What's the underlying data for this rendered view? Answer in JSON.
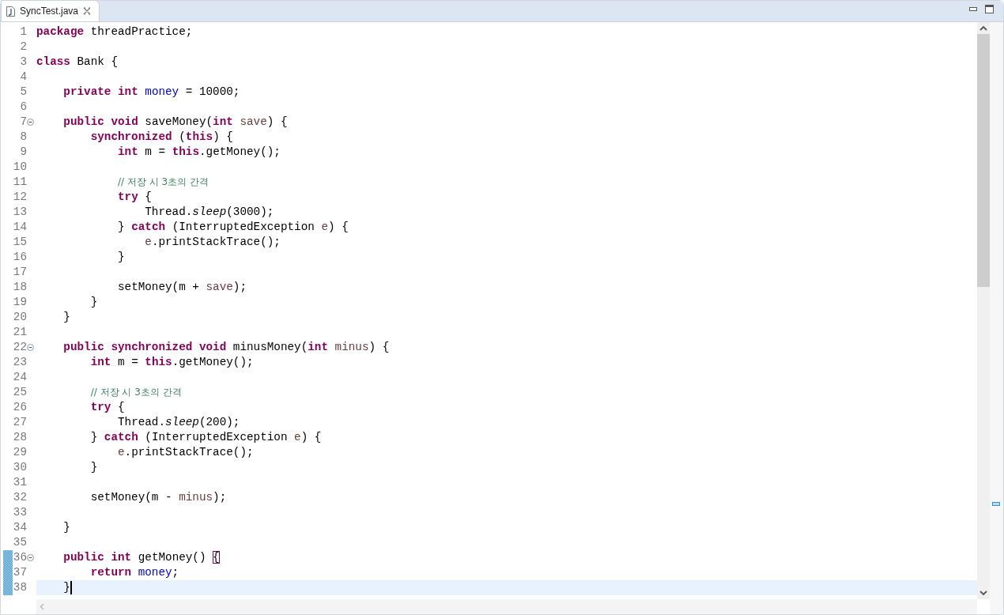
{
  "tab": {
    "title": "SyncTest.java",
    "selected": true
  },
  "lines": [
    {
      "number": "1",
      "tokens": [
        {
          "kind": "keyword",
          "text": "package"
        },
        {
          "kind": "plain",
          "text": " threadPractice;"
        }
      ]
    },
    {
      "number": "2"
    },
    {
      "number": "3",
      "tokens": [
        {
          "kind": "keyword",
          "text": "class"
        },
        {
          "kind": "plain",
          "text": " Bank {"
        }
      ]
    },
    {
      "number": "4"
    },
    {
      "number": "5",
      "tokens": [
        {
          "kind": "keyword",
          "text": "    private "
        },
        {
          "kind": "keyword",
          "text": "int "
        },
        {
          "kind": "field",
          "text": "money"
        },
        {
          "kind": "plain",
          "text": " = 10000;"
        }
      ]
    },
    {
      "number": "6"
    },
    {
      "number": "7",
      "foldable": true,
      "tokens": [
        {
          "kind": "keyword",
          "text": "    public "
        },
        {
          "kind": "keyword",
          "text": "void"
        },
        {
          "kind": "plain",
          "text": " saveMoney("
        },
        {
          "kind": "keyword",
          "text": "int "
        },
        {
          "kind": "param",
          "text": "save"
        },
        {
          "kind": "plain",
          "text": ") {"
        }
      ]
    },
    {
      "number": "8",
      "tokens": [
        {
          "kind": "keyword",
          "text": "        synchronized"
        },
        {
          "kind": "plain",
          "text": " ("
        },
        {
          "kind": "keyword",
          "text": "this"
        },
        {
          "kind": "plain",
          "text": ") {"
        }
      ]
    },
    {
      "number": "9",
      "tokens": [
        {
          "kind": "keyword",
          "text": "            int"
        },
        {
          "kind": "plain",
          "text": " m = "
        },
        {
          "kind": "keyword",
          "text": "this"
        },
        {
          "kind": "plain",
          "text": ".getMoney();"
        }
      ]
    },
    {
      "number": "10"
    },
    {
      "number": "11",
      "tokens": [
        {
          "kind": "comment",
          "text": "            // 저장 시 3초의 간격"
        }
      ]
    },
    {
      "number": "12",
      "tokens": [
        {
          "kind": "keyword",
          "text": "            try"
        },
        {
          "kind": "plain",
          "text": " {"
        }
      ]
    },
    {
      "number": "13",
      "tokens": [
        {
          "kind": "plain",
          "text": "                Thread."
        },
        {
          "kind": "static",
          "text": "sleep"
        },
        {
          "kind": "plain",
          "text": "(3000);"
        }
      ]
    },
    {
      "number": "14",
      "tokens": [
        {
          "kind": "plain",
          "text": "            } "
        },
        {
          "kind": "keyword",
          "text": "catch"
        },
        {
          "kind": "plain",
          "text": " (InterruptedException "
        },
        {
          "kind": "param",
          "text": "e"
        },
        {
          "kind": "plain",
          "text": ") {"
        }
      ]
    },
    {
      "number": "15",
      "tokens": [
        {
          "kind": "param",
          "text": "                e"
        },
        {
          "kind": "plain",
          "text": ".printStackTrace();"
        }
      ]
    },
    {
      "number": "16",
      "tokens": [
        {
          "kind": "plain",
          "text": "            }"
        }
      ]
    },
    {
      "number": "17"
    },
    {
      "number": "18",
      "tokens": [
        {
          "kind": "plain",
          "text": "            setMoney(m + "
        },
        {
          "kind": "param",
          "text": "save"
        },
        {
          "kind": "plain",
          "text": ");"
        }
      ]
    },
    {
      "number": "19",
      "tokens": [
        {
          "kind": "plain",
          "text": "        }"
        }
      ]
    },
    {
      "number": "20",
      "tokens": [
        {
          "kind": "plain",
          "text": "    }"
        }
      ]
    },
    {
      "number": "21"
    },
    {
      "number": "22",
      "foldable": true,
      "tokens": [
        {
          "kind": "keyword",
          "text": "    public "
        },
        {
          "kind": "keyword",
          "text": "synchronized "
        },
        {
          "kind": "keyword",
          "text": "void"
        },
        {
          "kind": "plain",
          "text": " minusMoney("
        },
        {
          "kind": "keyword",
          "text": "int "
        },
        {
          "kind": "param",
          "text": "minus"
        },
        {
          "kind": "plain",
          "text": ") {"
        }
      ]
    },
    {
      "number": "23",
      "tokens": [
        {
          "kind": "keyword",
          "text": "        int"
        },
        {
          "kind": "plain",
          "text": " m = "
        },
        {
          "kind": "keyword",
          "text": "this"
        },
        {
          "kind": "plain",
          "text": ".getMoney();"
        }
      ]
    },
    {
      "number": "24"
    },
    {
      "number": "25",
      "tokens": [
        {
          "kind": "comment",
          "text": "        // 저장 시 3초의 간격"
        }
      ]
    },
    {
      "number": "26",
      "tokens": [
        {
          "kind": "keyword",
          "text": "        try"
        },
        {
          "kind": "plain",
          "text": " {"
        }
      ]
    },
    {
      "number": "27",
      "tokens": [
        {
          "kind": "plain",
          "text": "            Thread."
        },
        {
          "kind": "static",
          "text": "sleep"
        },
        {
          "kind": "plain",
          "text": "(200);"
        }
      ]
    },
    {
      "number": "28",
      "tokens": [
        {
          "kind": "plain",
          "text": "        } "
        },
        {
          "kind": "keyword",
          "text": "catch"
        },
        {
          "kind": "plain",
          "text": " (InterruptedException "
        },
        {
          "kind": "param",
          "text": "e"
        },
        {
          "kind": "plain",
          "text": ") {"
        }
      ]
    },
    {
      "number": "29",
      "tokens": [
        {
          "kind": "param",
          "text": "            e"
        },
        {
          "kind": "plain",
          "text": ".printStackTrace();"
        }
      ]
    },
    {
      "number": "30",
      "tokens": [
        {
          "kind": "plain",
          "text": "        }"
        }
      ]
    },
    {
      "number": "31"
    },
    {
      "number": "32",
      "tokens": [
        {
          "kind": "plain",
          "text": "        setMoney(m - "
        },
        {
          "kind": "param",
          "text": "minus"
        },
        {
          "kind": "plain",
          "text": ");"
        }
      ]
    },
    {
      "number": "33"
    },
    {
      "number": "34",
      "tokens": [
        {
          "kind": "plain",
          "text": "    }"
        }
      ]
    },
    {
      "number": "35"
    },
    {
      "number": "36",
      "foldable": true,
      "changed": true,
      "tokens": [
        {
          "kind": "keyword",
          "text": "    public "
        },
        {
          "kind": "keyword",
          "text": "int"
        },
        {
          "kind": "plain",
          "text": " getMoney() "
        },
        {
          "kind": "bracket",
          "text": "{"
        }
      ]
    },
    {
      "number": "37",
      "changed": true,
      "tokens": [
        {
          "kind": "keyword",
          "text": "        return "
        },
        {
          "kind": "field",
          "text": "money"
        },
        {
          "kind": "plain",
          "text": ";"
        }
      ]
    },
    {
      "number": "38",
      "changed": true,
      "current": true,
      "caret": true,
      "tokens": [
        {
          "kind": "plain",
          "text": "    }"
        }
      ]
    }
  ]
}
